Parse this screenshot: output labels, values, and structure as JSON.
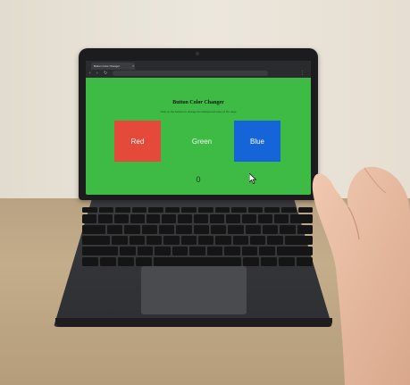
{
  "browser": {
    "tab_title": "Button Color Changer",
    "tab_close": "×",
    "url": "",
    "back_icon": "back-arrow-icon",
    "forward_icon": "forward-arrow-icon",
    "reload_icon": "reload-icon"
  },
  "page": {
    "title": "Button Color Changer",
    "subtitle": "Click on the buttons to change the background color of the page",
    "background_color": "#3dbb45",
    "buttons": [
      {
        "label": "Red",
        "color": "#e4493a"
      },
      {
        "label": "Green",
        "color": "#3dbb45"
      },
      {
        "label": "Blue",
        "color": "#1565d8"
      }
    ],
    "counter": "0"
  },
  "colors": {
    "laptop": "#1c1c1e",
    "desk": "#c4ad8b",
    "wall": "#e8e2d7"
  }
}
